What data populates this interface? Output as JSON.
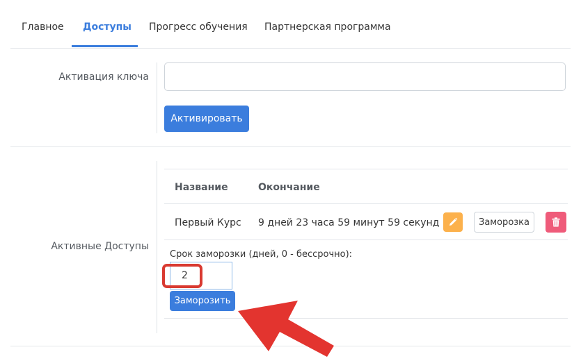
{
  "tabs": [
    {
      "label": "Главное"
    },
    {
      "label": "Доступы",
      "active": true
    },
    {
      "label": "Прогресс обучения"
    },
    {
      "label": "Партнерская программа"
    }
  ],
  "key_activation": {
    "label": "Активация ключа",
    "input_value": "",
    "button_label": "Активировать"
  },
  "access": {
    "label": "Активные Доступы",
    "columns": [
      "Название",
      "Окончание"
    ],
    "rows": [
      {
        "name": "Первый Курс",
        "end": "9 дней 23 часа 59 минут 59 секунд",
        "freeze_label": "Заморозка"
      }
    ],
    "freeze_form": {
      "label": "Срок заморозки (дней, 0 - бессрочно):",
      "value": "2",
      "button_label": "Заморозить"
    }
  },
  "colors": {
    "primary": "#3b7ddd",
    "warning": "#fcb14c",
    "danger": "#ef5b7a",
    "annotation": "#d93a31"
  },
  "icons": {
    "edit": "pencil-icon",
    "delete": "trash-icon",
    "annotation": "arrow-icon"
  }
}
